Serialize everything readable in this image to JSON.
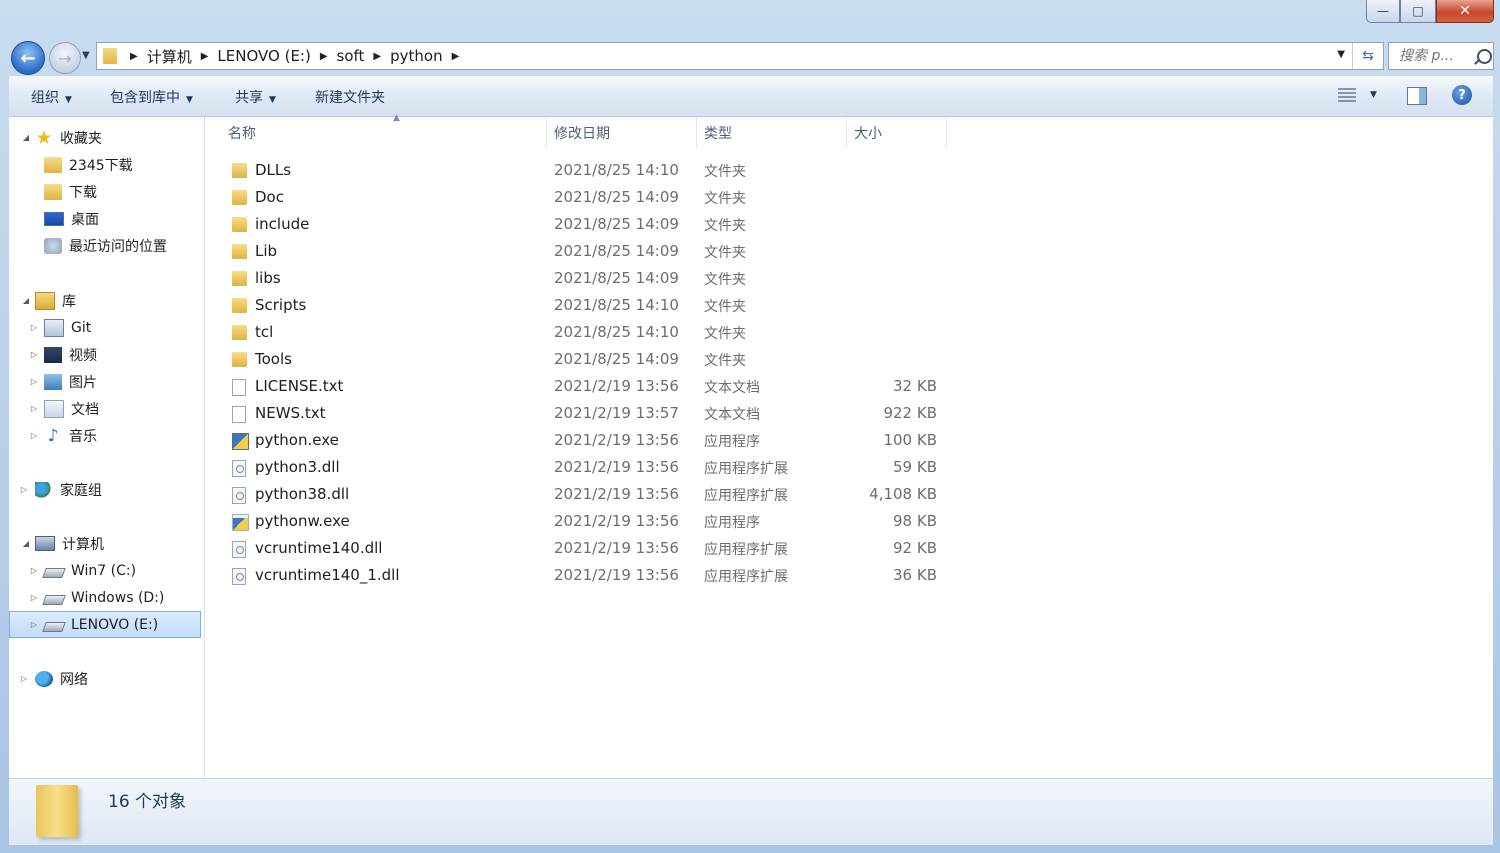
{
  "window": {
    "minimize_label": "—",
    "maximize_label": "□",
    "close_label": "✕"
  },
  "nav": {
    "back_label": "←",
    "forward_label": "→",
    "breadcrumbs": [
      "计算机",
      "LENOVO (E:)",
      "soft",
      "python"
    ],
    "search_placeholder": "搜索 p..."
  },
  "toolbar": {
    "organize": "组织",
    "include_in_library": "包含到库中",
    "share": "共享",
    "new_folder": "新建文件夹",
    "help": "?"
  },
  "sidebar": {
    "favorites": {
      "label": "收藏夹",
      "items": [
        "2345下载",
        "下载",
        "桌面",
        "最近访问的位置"
      ]
    },
    "libraries": {
      "label": "库",
      "items": [
        "Git",
        "视频",
        "图片",
        "文档",
        "音乐"
      ]
    },
    "homegroup": "家庭组",
    "computer": {
      "label": "计算机",
      "items": [
        "Win7 (C:)",
        "Windows (D:)",
        "LENOVO (E:)"
      ]
    },
    "network": "网络"
  },
  "columns": {
    "name": "名称",
    "modified": "修改日期",
    "type": "类型",
    "size": "大小"
  },
  "files": [
    {
      "name": "DLLs",
      "date": "2021/8/25 14:10",
      "type": "文件夹",
      "size": ""
    },
    {
      "name": "Doc",
      "date": "2021/8/25 14:09",
      "type": "文件夹",
      "size": ""
    },
    {
      "name": "include",
      "date": "2021/8/25 14:09",
      "type": "文件夹",
      "size": ""
    },
    {
      "name": "Lib",
      "date": "2021/8/25 14:09",
      "type": "文件夹",
      "size": ""
    },
    {
      "name": "libs",
      "date": "2021/8/25 14:09",
      "type": "文件夹",
      "size": ""
    },
    {
      "name": "Scripts",
      "date": "2021/8/25 14:10",
      "type": "文件夹",
      "size": ""
    },
    {
      "name": "tcl",
      "date": "2021/8/25 14:10",
      "type": "文件夹",
      "size": ""
    },
    {
      "name": "Tools",
      "date": "2021/8/25 14:09",
      "type": "文件夹",
      "size": ""
    },
    {
      "name": "LICENSE.txt",
      "date": "2021/2/19 13:56",
      "type": "文本文档",
      "size": "32 KB"
    },
    {
      "name": "NEWS.txt",
      "date": "2021/2/19 13:57",
      "type": "文本文档",
      "size": "922 KB"
    },
    {
      "name": "python.exe",
      "date": "2021/2/19 13:56",
      "type": "应用程序",
      "size": "100 KB"
    },
    {
      "name": "python3.dll",
      "date": "2021/2/19 13:56",
      "type": "应用程序扩展",
      "size": "59 KB"
    },
    {
      "name": "python38.dll",
      "date": "2021/2/19 13:56",
      "type": "应用程序扩展",
      "size": "4,108 KB"
    },
    {
      "name": "pythonw.exe",
      "date": "2021/2/19 13:56",
      "type": "应用程序",
      "size": "98 KB"
    },
    {
      "name": "vcruntime140.dll",
      "date": "2021/2/19 13:56",
      "type": "应用程序扩展",
      "size": "92 KB"
    },
    {
      "name": "vcruntime140_1.dll",
      "date": "2021/2/19 13:56",
      "type": "应用程序扩展",
      "size": "36 KB"
    }
  ],
  "status": {
    "count_text": "16 个对象"
  }
}
